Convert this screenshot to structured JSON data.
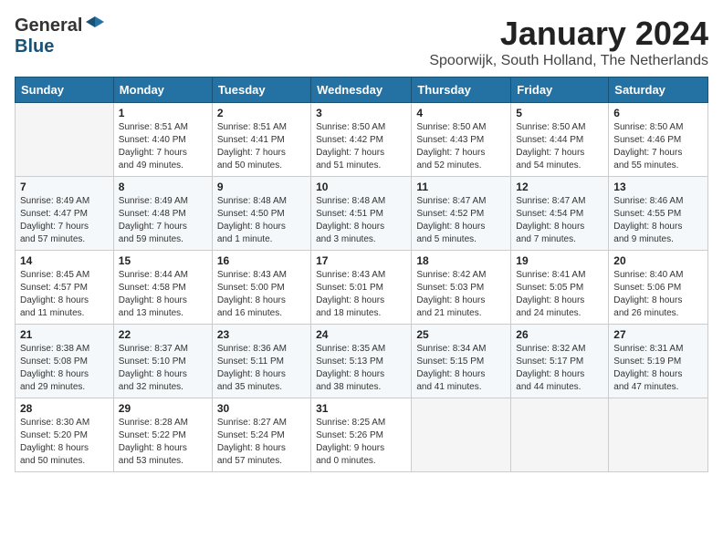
{
  "logo": {
    "general": "General",
    "blue": "Blue"
  },
  "title": "January 2024",
  "subtitle": "Spoorwijk, South Holland, The Netherlands",
  "days_header": [
    "Sunday",
    "Monday",
    "Tuesday",
    "Wednesday",
    "Thursday",
    "Friday",
    "Saturday"
  ],
  "weeks": [
    [
      {
        "day": "",
        "info": ""
      },
      {
        "day": "1",
        "info": "Sunrise: 8:51 AM\nSunset: 4:40 PM\nDaylight: 7 hours\nand 49 minutes."
      },
      {
        "day": "2",
        "info": "Sunrise: 8:51 AM\nSunset: 4:41 PM\nDaylight: 7 hours\nand 50 minutes."
      },
      {
        "day": "3",
        "info": "Sunrise: 8:50 AM\nSunset: 4:42 PM\nDaylight: 7 hours\nand 51 minutes."
      },
      {
        "day": "4",
        "info": "Sunrise: 8:50 AM\nSunset: 4:43 PM\nDaylight: 7 hours\nand 52 minutes."
      },
      {
        "day": "5",
        "info": "Sunrise: 8:50 AM\nSunset: 4:44 PM\nDaylight: 7 hours\nand 54 minutes."
      },
      {
        "day": "6",
        "info": "Sunrise: 8:50 AM\nSunset: 4:46 PM\nDaylight: 7 hours\nand 55 minutes."
      }
    ],
    [
      {
        "day": "7",
        "info": "Sunrise: 8:49 AM\nSunset: 4:47 PM\nDaylight: 7 hours\nand 57 minutes."
      },
      {
        "day": "8",
        "info": "Sunrise: 8:49 AM\nSunset: 4:48 PM\nDaylight: 7 hours\nand 59 minutes."
      },
      {
        "day": "9",
        "info": "Sunrise: 8:48 AM\nSunset: 4:50 PM\nDaylight: 8 hours\nand 1 minute."
      },
      {
        "day": "10",
        "info": "Sunrise: 8:48 AM\nSunset: 4:51 PM\nDaylight: 8 hours\nand 3 minutes."
      },
      {
        "day": "11",
        "info": "Sunrise: 8:47 AM\nSunset: 4:52 PM\nDaylight: 8 hours\nand 5 minutes."
      },
      {
        "day": "12",
        "info": "Sunrise: 8:47 AM\nSunset: 4:54 PM\nDaylight: 8 hours\nand 7 minutes."
      },
      {
        "day": "13",
        "info": "Sunrise: 8:46 AM\nSunset: 4:55 PM\nDaylight: 8 hours\nand 9 minutes."
      }
    ],
    [
      {
        "day": "14",
        "info": "Sunrise: 8:45 AM\nSunset: 4:57 PM\nDaylight: 8 hours\nand 11 minutes."
      },
      {
        "day": "15",
        "info": "Sunrise: 8:44 AM\nSunset: 4:58 PM\nDaylight: 8 hours\nand 13 minutes."
      },
      {
        "day": "16",
        "info": "Sunrise: 8:43 AM\nSunset: 5:00 PM\nDaylight: 8 hours\nand 16 minutes."
      },
      {
        "day": "17",
        "info": "Sunrise: 8:43 AM\nSunset: 5:01 PM\nDaylight: 8 hours\nand 18 minutes."
      },
      {
        "day": "18",
        "info": "Sunrise: 8:42 AM\nSunset: 5:03 PM\nDaylight: 8 hours\nand 21 minutes."
      },
      {
        "day": "19",
        "info": "Sunrise: 8:41 AM\nSunset: 5:05 PM\nDaylight: 8 hours\nand 24 minutes."
      },
      {
        "day": "20",
        "info": "Sunrise: 8:40 AM\nSunset: 5:06 PM\nDaylight: 8 hours\nand 26 minutes."
      }
    ],
    [
      {
        "day": "21",
        "info": "Sunrise: 8:38 AM\nSunset: 5:08 PM\nDaylight: 8 hours\nand 29 minutes."
      },
      {
        "day": "22",
        "info": "Sunrise: 8:37 AM\nSunset: 5:10 PM\nDaylight: 8 hours\nand 32 minutes."
      },
      {
        "day": "23",
        "info": "Sunrise: 8:36 AM\nSunset: 5:11 PM\nDaylight: 8 hours\nand 35 minutes."
      },
      {
        "day": "24",
        "info": "Sunrise: 8:35 AM\nSunset: 5:13 PM\nDaylight: 8 hours\nand 38 minutes."
      },
      {
        "day": "25",
        "info": "Sunrise: 8:34 AM\nSunset: 5:15 PM\nDaylight: 8 hours\nand 41 minutes."
      },
      {
        "day": "26",
        "info": "Sunrise: 8:32 AM\nSunset: 5:17 PM\nDaylight: 8 hours\nand 44 minutes."
      },
      {
        "day": "27",
        "info": "Sunrise: 8:31 AM\nSunset: 5:19 PM\nDaylight: 8 hours\nand 47 minutes."
      }
    ],
    [
      {
        "day": "28",
        "info": "Sunrise: 8:30 AM\nSunset: 5:20 PM\nDaylight: 8 hours\nand 50 minutes."
      },
      {
        "day": "29",
        "info": "Sunrise: 8:28 AM\nSunset: 5:22 PM\nDaylight: 8 hours\nand 53 minutes."
      },
      {
        "day": "30",
        "info": "Sunrise: 8:27 AM\nSunset: 5:24 PM\nDaylight: 8 hours\nand 57 minutes."
      },
      {
        "day": "31",
        "info": "Sunrise: 8:25 AM\nSunset: 5:26 PM\nDaylight: 9 hours\nand 0 minutes."
      },
      {
        "day": "",
        "info": ""
      },
      {
        "day": "",
        "info": ""
      },
      {
        "day": "",
        "info": ""
      }
    ]
  ]
}
